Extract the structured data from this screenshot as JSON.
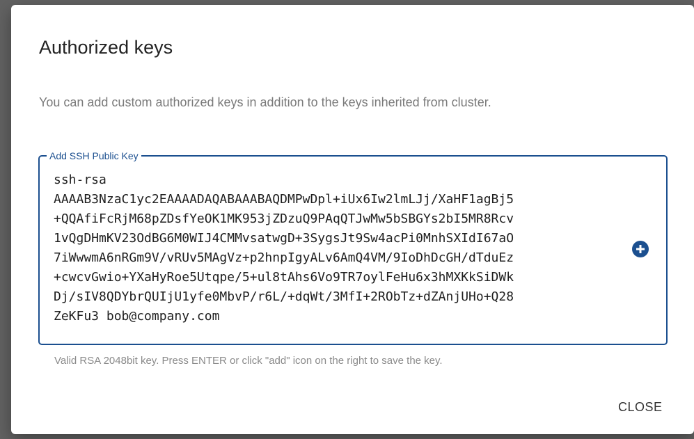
{
  "dialog": {
    "title": "Authorized keys",
    "description": "You can add custom authorized keys in addition to the keys inherited from cluster.",
    "key_field": {
      "label": "Add SSH Public Key",
      "value": "ssh-rsa\nAAAAB3NzaC1yc2EAAAADAQABAAABAQDMPwDpl+iUx6Iw2lmLJj/XaHF1agBj5\n+QQAfiFcRjM68pZDsfYeOK1MK953jZDzuQ9PAqQTJwMw5bSBGYs2bI5MR8Rcv\n1vQgDHmKV23OdBG6M0WIJ4CMMvsatwgD+3SygsJt9Sw4acPi0MnhSXIdI67aO\n7iWwwmA6nRGm9V/vRUv5MAgVz+p2hnpIgyALv6AmQ4VM/9IoDhDcGH/dTduEz\n+cwcvGwio+YXaHyRoe5Utqpe/5+ul8tAhs6Vo9TR7oylFeHu6x3hMXKkSiDWk\nDj/sIV8QDYbrQUIjU1yfe0MbvP/r6L/+dqWt/3MfI+2RObTz+dZAnjUHo+Q28\nZeKFu3 bob@company.com",
      "add_icon": "plus-circle-icon",
      "helper_text": "Valid RSA 2048bit key. Press ENTER or click \"add\" icon on the right to save the key."
    },
    "close_label": "CLOSE"
  },
  "colors": {
    "accent": "#1b4f8f",
    "backdrop": "#626262",
    "surface": "#ffffff"
  }
}
